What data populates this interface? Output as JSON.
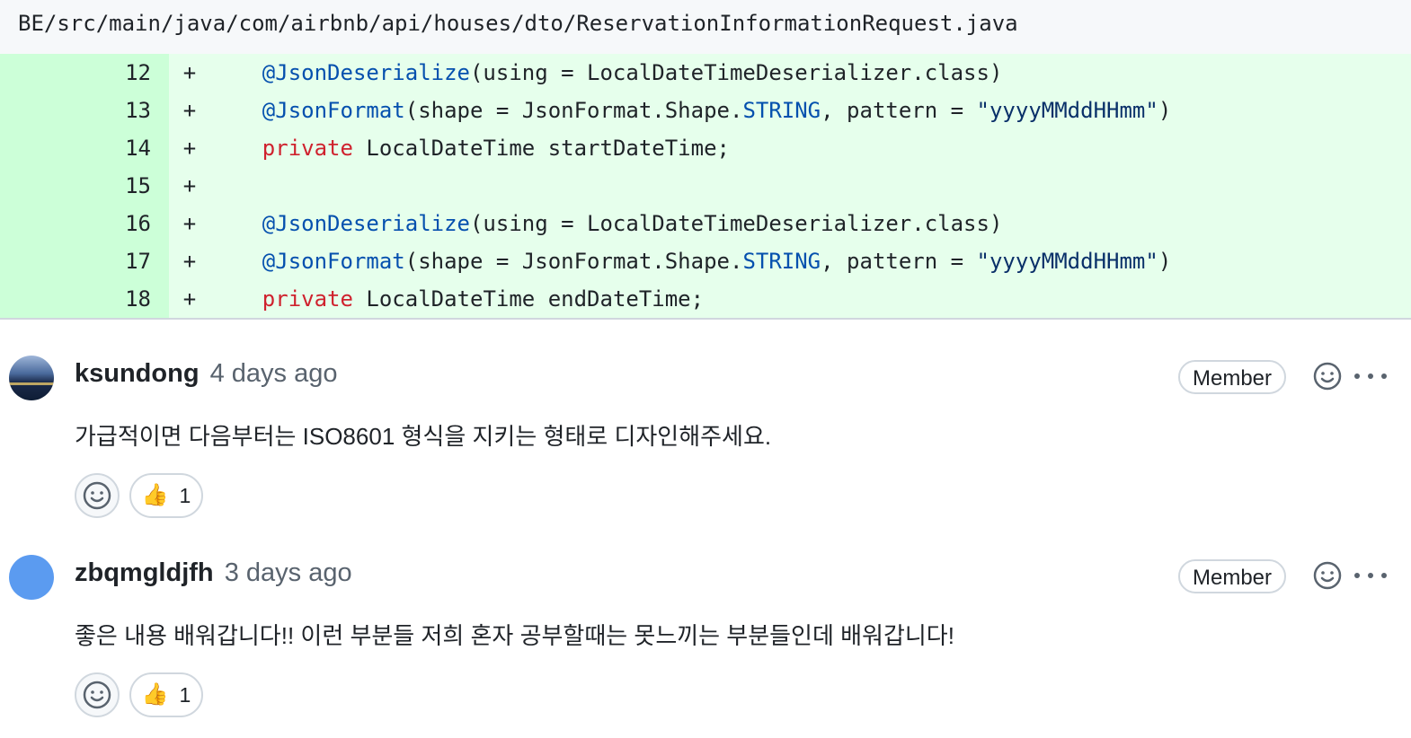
{
  "file": {
    "path": "BE/src/main/java/com/airbnb/api/houses/dto/ReservationInformationRequest.java"
  },
  "diff": {
    "rows": [
      {
        "line": "12",
        "marker": "+",
        "tokens": [
          {
            "t": "ann",
            "v": "@JsonDeserialize"
          },
          {
            "t": "plain",
            "v": "(using = LocalDateTimeDeserializer.class)"
          }
        ]
      },
      {
        "line": "13",
        "marker": "+",
        "tokens": [
          {
            "t": "ann",
            "v": "@JsonFormat"
          },
          {
            "t": "plain",
            "v": "(shape = JsonFormat.Shape."
          },
          {
            "t": "const",
            "v": "STRING"
          },
          {
            "t": "plain",
            "v": ", pattern = "
          },
          {
            "t": "str",
            "v": "\"yyyyMMddHHmm\""
          },
          {
            "t": "plain",
            "v": ")"
          }
        ]
      },
      {
        "line": "14",
        "marker": "+",
        "tokens": [
          {
            "t": "kw",
            "v": "private"
          },
          {
            "t": "plain",
            "v": " LocalDateTime startDateTime;"
          }
        ]
      },
      {
        "line": "15",
        "marker": "+",
        "tokens": []
      },
      {
        "line": "16",
        "marker": "+",
        "tokens": [
          {
            "t": "ann",
            "v": "@JsonDeserialize"
          },
          {
            "t": "plain",
            "v": "(using = LocalDateTimeDeserializer.class)"
          }
        ]
      },
      {
        "line": "17",
        "marker": "+",
        "tokens": [
          {
            "t": "ann",
            "v": "@JsonFormat"
          },
          {
            "t": "plain",
            "v": "(shape = JsonFormat.Shape."
          },
          {
            "t": "const",
            "v": "STRING"
          },
          {
            "t": "plain",
            "v": ", pattern = "
          },
          {
            "t": "str",
            "v": "\"yyyyMMddHHmm\""
          },
          {
            "t": "plain",
            "v": ")"
          }
        ]
      },
      {
        "line": "18",
        "marker": "+",
        "tokens": [
          {
            "t": "kw",
            "v": "private"
          },
          {
            "t": "plain",
            "v": " LocalDateTime endDateTime;"
          }
        ]
      }
    ]
  },
  "comments": [
    {
      "author": "ksundong",
      "time": "4 days ago",
      "role": "Member",
      "body": "가급적이면 다음부터는 ISO8601 형식을 지키는 형태로 디자인해주세요.",
      "reactions": [
        {
          "emoji": "👍",
          "count": "1"
        }
      ]
    },
    {
      "author": "zbqmgldjfh",
      "time": "3 days ago",
      "role": "Member",
      "body": "좋은 내용 배워갑니다!! 이런 부분들 저희 혼자 공부할때는 못느끼는 부분들인데 배워갑니다!",
      "reactions": [
        {
          "emoji": "👍",
          "count": "1"
        }
      ]
    }
  ],
  "icons": {
    "add_reaction": "smiley-icon",
    "more": "kebab-horizontal-icon",
    "thumbs_up": "thumbs-up-icon"
  }
}
